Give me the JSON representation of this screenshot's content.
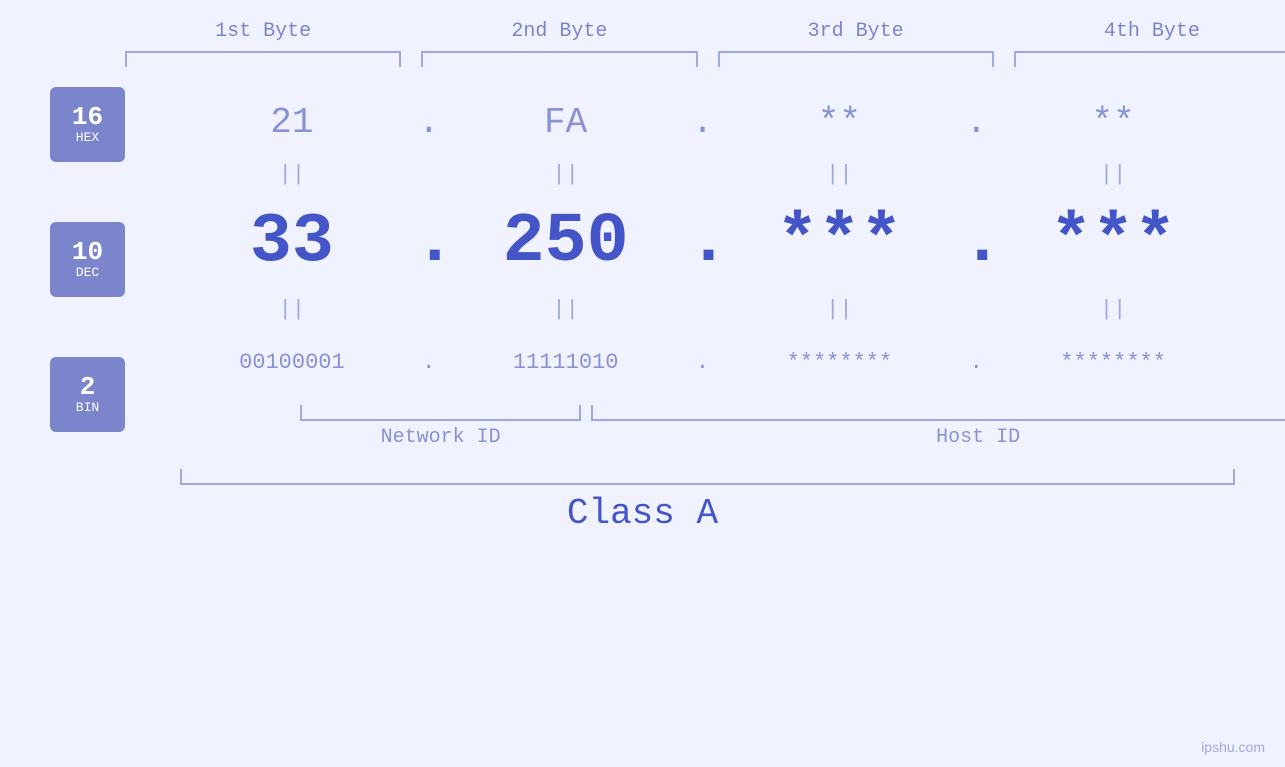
{
  "headers": {
    "byte1": "1st Byte",
    "byte2": "2nd Byte",
    "byte3": "3rd Byte",
    "byte4": "4th Byte"
  },
  "badges": [
    {
      "number": "16",
      "label": "HEX"
    },
    {
      "number": "10",
      "label": "DEC"
    },
    {
      "number": "2",
      "label": "BIN"
    }
  ],
  "hex_row": {
    "b1": "21",
    "b2": "FA",
    "b3": "**",
    "b4": "**",
    "dot": "."
  },
  "dec_row": {
    "b1": "33",
    "b2": "250",
    "b3": "***",
    "b4": "***",
    "dot": "."
  },
  "bin_row": {
    "b1": "00100001",
    "b2": "11111010",
    "b3": "********",
    "b4": "********",
    "dot": "."
  },
  "labels": {
    "network_id": "Network ID",
    "host_id": "Host ID",
    "class": "Class A"
  },
  "watermark": "ipshu.com",
  "equals": "||"
}
